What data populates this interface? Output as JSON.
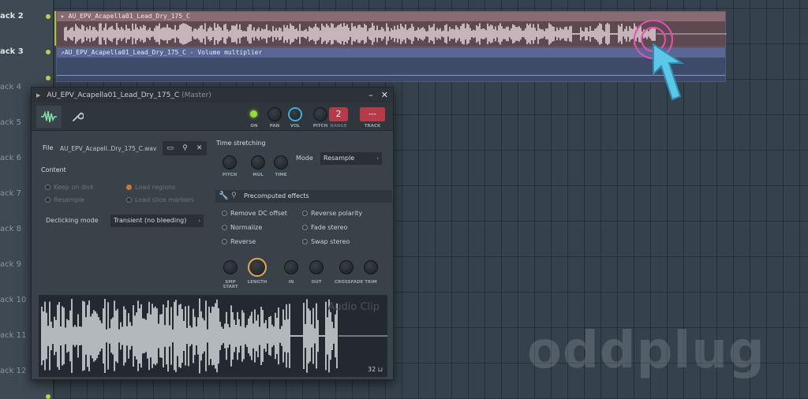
{
  "playlist": {
    "tracks": [
      {
        "label": "ack 2",
        "active": true
      },
      {
        "label": "ack 3",
        "active": true
      },
      {
        "label": "ack 4",
        "active": false
      },
      {
        "label": "ack 5",
        "active": false
      },
      {
        "label": "ack 6",
        "active": false
      },
      {
        "label": "ack 7",
        "active": false
      },
      {
        "label": "ack 8",
        "active": false
      },
      {
        "label": "ack 9",
        "active": false
      },
      {
        "label": "ack 10",
        "active": false
      },
      {
        "label": "ack 11",
        "active": false
      },
      {
        "label": "ack 12",
        "active": false
      }
    ],
    "audio_clip_title": "AU_EPV_Acapella01_Lead_Dry_175_C",
    "automation_clip_title": "AU_EPV_Acapella01_Lead_Dry_175_C - Volume multiplier",
    "colors": {
      "audio_clip": "#8a6b73",
      "automation_clip": "#5a6694",
      "track_dot": "#b9d24a"
    }
  },
  "window": {
    "title": "AU_EPV_Acapella01_Lead_Dry_175_C",
    "title_sub": "(Master)",
    "minimize_label": "–",
    "close_label": "✕",
    "toolbar": {
      "tabs": [
        {
          "icon": "waveform-icon"
        },
        {
          "icon": "wrench-icon"
        }
      ],
      "on_label": "ON",
      "pan_label": "PAN",
      "vol_label": "VOL",
      "pitch_label": "PITCH",
      "range_label": "RANGE",
      "pitch_value": "2",
      "track_label": "TRACK",
      "track_value": "---"
    },
    "file": {
      "label": "File",
      "value": "AU_EPV_Acapell..Dry_175_C.wav"
    },
    "content": {
      "heading": "Content",
      "keep_on_disk": "Keep on disk",
      "load_regions": "Load regions",
      "resample": "Resample",
      "load_slice_markers": "Load slice markers"
    },
    "declicking": {
      "label": "Declicking mode",
      "value": "Transient (no bleeding)"
    },
    "time_stretching": {
      "heading": "Time stretching",
      "pitch_label": "PITCH",
      "mul_label": "MUL",
      "time_label": "TIME",
      "mode_label": "Mode",
      "mode_value": "Resample"
    },
    "precomputed": {
      "heading": "Precomputed effects",
      "remove_dc": "Remove DC offset",
      "reverse_polarity": "Reverse polarity",
      "normalize": "Normalize",
      "fade_stereo": "Fade stereo",
      "reverse": "Reverse",
      "swap_stereo": "Swap stereo",
      "knobs": [
        "SMP START",
        "LENGTH",
        "IN",
        "OUT",
        "CROSSFADE",
        "TRIM"
      ]
    },
    "waveform": {
      "watermark": "Audio Clip",
      "zoom_value": "32"
    }
  },
  "branding": {
    "watermark": "oddplug"
  }
}
